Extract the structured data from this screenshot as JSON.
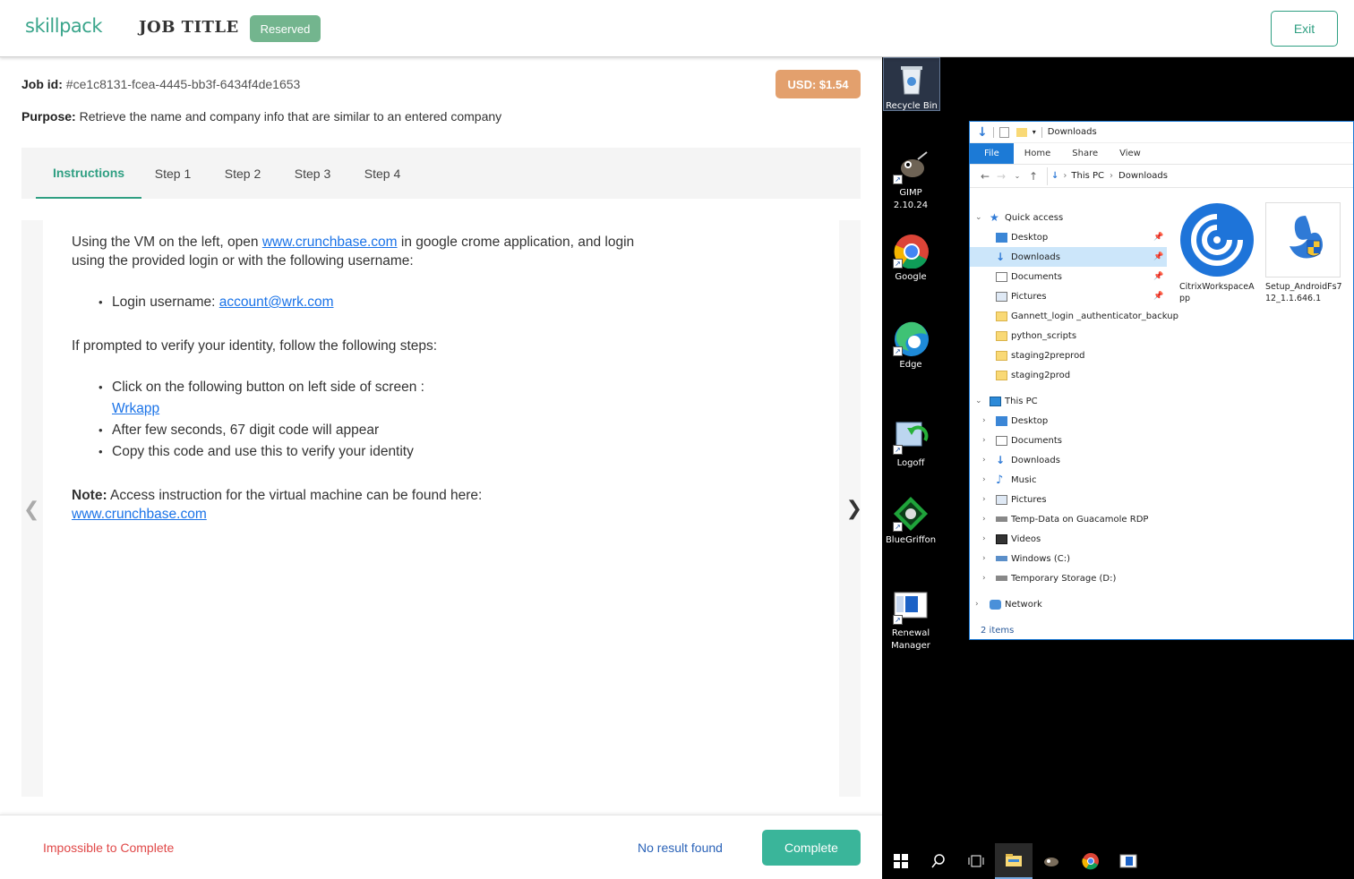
{
  "header": {
    "logo": "skillpack",
    "job_title": "JOB TITLE",
    "status_badge": "Reserved",
    "exit_label": "Exit"
  },
  "job": {
    "id_label": "Job id:",
    "id_value": "#ce1c8131-fcea-4445-bb3f-6434f4de1653",
    "price": "USD: $1.54",
    "purpose_label": "Purpose:",
    "purpose_value": "Retrieve the name and company info that are similar to an entered company"
  },
  "tabs": [
    "Instructions",
    "Step 1",
    "Step 2",
    "Step 3",
    "Step 4"
  ],
  "instructions": {
    "p1_before": "Using the VM on the left, open ",
    "p1_link": "www.crunchbase.com",
    "p1_after": " in google crome application, and login using the provided login or with the following username:",
    "login_label": "Login username: ",
    "login_link": "account@wrk.com",
    "p2": "If prompted to verify your identity, follow the following steps:",
    "step1": "Click on the following button on left side of screen :",
    "step1_link": "Wrkapp",
    "step2": "After few seconds, 67 digit code will appear",
    "step3": "Copy this code and use this to verify your identity",
    "note_label": "Note:",
    "note_text": " Access instruction for the virtual machine can be found here:",
    "note_link": "www.crunchbase.com"
  },
  "footer": {
    "impossible": "Impossible to Complete",
    "no_result": "No result found",
    "complete": "Complete"
  },
  "desktop": {
    "icons": [
      {
        "label": "Recycle Bin",
        "icon": "recycle-bin-icon"
      },
      {
        "label": "GIMP 2.10.24",
        "icon": "gimp-icon"
      },
      {
        "label": "Google",
        "icon": "chrome-icon"
      },
      {
        "label": "Edge",
        "icon": "edge-icon"
      },
      {
        "label": "Logoff",
        "icon": "logoff-icon"
      },
      {
        "label": "BlueGriffon",
        "icon": "bluegriffon-icon"
      },
      {
        "label": "Renewal Manager",
        "icon": "renewal-manager-icon"
      }
    ],
    "explorer": {
      "title": "Downloads",
      "ribbon_tabs": [
        "File",
        "Home",
        "Share",
        "View"
      ],
      "breadcrumb": [
        "This PC",
        "Downloads"
      ],
      "quick_access_label": "Quick access",
      "quick_access": [
        "Desktop",
        "Downloads",
        "Documents",
        "Pictures",
        "Gannett_login _authenticator_backup",
        "python_scripts",
        "staging2preprod",
        "staging2prod"
      ],
      "this_pc_label": "This PC",
      "this_pc": [
        "Desktop",
        "Documents",
        "Downloads",
        "Music",
        "Pictures",
        "Temp-Data on Guacamole RDP",
        "Videos",
        "Windows (C:)",
        "Temporary Storage (D:)"
      ],
      "network_label": "Network",
      "files": [
        "CitrixWorkspaceApp",
        "Setup_AndroidFs712_1.1.646.1"
      ],
      "status": "2 items"
    }
  },
  "colors": {
    "brand": "#3aa58b",
    "reserved": "#73b58e",
    "price": "#e3a06d",
    "complete": "#3ab59a",
    "danger": "#e04848",
    "link": "#1a73e8"
  }
}
